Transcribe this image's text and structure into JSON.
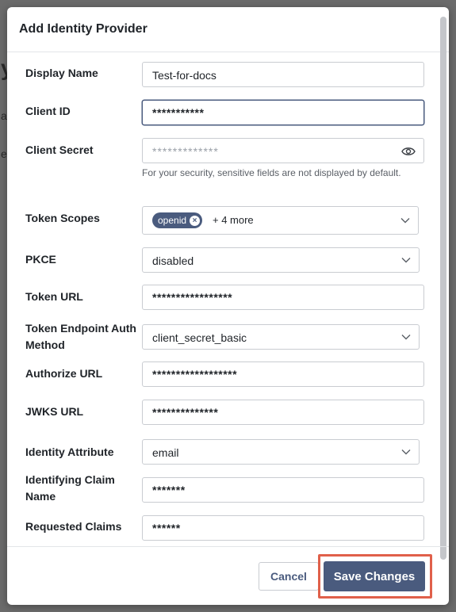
{
  "background": {
    "fragments": [
      "y",
      "a",
      "e"
    ]
  },
  "dialog": {
    "title": "Add Identity Provider"
  },
  "form": {
    "display_name": {
      "label": "Display Name",
      "value": "Test-for-docs"
    },
    "client_id": {
      "label": "Client ID",
      "value": "***********"
    },
    "client_secret": {
      "label": "Client Secret",
      "placeholder": "*************",
      "help": "For your security, sensitive fields are not displayed by default."
    },
    "token_scopes": {
      "label": "Token Scopes",
      "chip": "openid",
      "more": "+ 4 more"
    },
    "pkce": {
      "label": "PKCE",
      "value": "disabled"
    },
    "token_url": {
      "label": "Token URL",
      "value": "*****************"
    },
    "token_endpoint_auth": {
      "label": "Token Endpoint Auth Method",
      "value": "client_secret_basic"
    },
    "authorize_url": {
      "label": "Authorize URL",
      "value": "******************"
    },
    "jwks_url": {
      "label": "JWKS URL",
      "value": "**************"
    },
    "identity_attribute": {
      "label": "Identity Attribute",
      "value": "email"
    },
    "identifying_claim_name": {
      "label": "Identifying Claim Name",
      "value": "*******"
    },
    "requested_claims": {
      "label": "Requested Claims",
      "value": "******"
    }
  },
  "footer": {
    "cancel_label": "Cancel",
    "save_label": "Save Changes"
  },
  "colors": {
    "accent": "#4a5b7e",
    "highlight": "#e0604a",
    "overlay": "#6b6b6b"
  },
  "icons": {
    "eye": "eye-icon",
    "chevron": "chevron-down-icon",
    "chip_remove": "close-circle-icon"
  }
}
